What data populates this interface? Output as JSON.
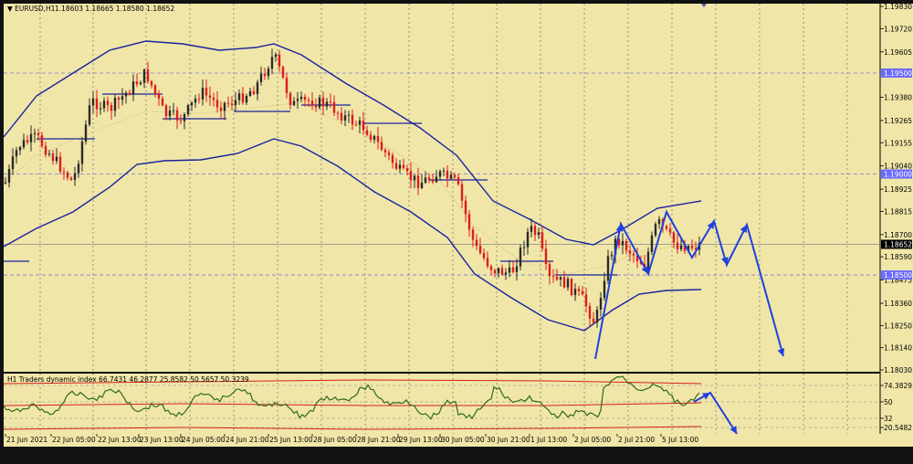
{
  "window": {
    "symbol_label": "▼ EURUSD,H1",
    "ohlc": "1.18603 1.18665 1.18580 1.18652"
  },
  "indicator": {
    "label": "H1 Traders dynamic index 66.7431 46.2877 25.8582 50.5657 50.3239",
    "levels": [
      {
        "value": "74.3829"
      },
      {
        "value": "50"
      },
      {
        "value": "32"
      },
      {
        "value": "20.5482"
      }
    ]
  },
  "colors": {
    "background": "#f0e6a8",
    "grid": "#707070",
    "bollinger": "#1a22a0",
    "bull": "#2a2a2a",
    "bear": "#e01a1a",
    "arrow": "#1f3fe0",
    "price_tag_bg": "#000000",
    "level_tag_bg": "#6b6bff",
    "tdi_green": "#2e6b1a",
    "tdi_red": "#d62020"
  },
  "price_axis": {
    "ticks": [
      "1.19830",
      "1.19720",
      "1.19605",
      "1.19380",
      "1.19265",
      "1.19155",
      "1.19040",
      "1.18925",
      "1.18815",
      "1.18700",
      "1.18590",
      "1.18475",
      "1.18360",
      "1.18250",
      "1.18140",
      "1.18030"
    ],
    "current_price": "1.18652",
    "level_tags": [
      "1.19500",
      "1.19000",
      "1.18500"
    ]
  },
  "time_axis": [
    "21 Jun 2021",
    "22 Jun 05:00",
    "22 Jun 13:00",
    "23 Jun 13:00",
    "24 Jun 05:00",
    "24 Jun 21:00",
    "25 Jun 13:00",
    "28 Jun 05:00",
    "28 Jun 21:00",
    "29 Jun 13:00",
    "30 Jun 05:00",
    "30 Jun 21:00",
    "1 Jul 13:00",
    "2 Jul 05:00",
    "2 Jul 21:00",
    "5 Jul 13:00"
  ]
}
